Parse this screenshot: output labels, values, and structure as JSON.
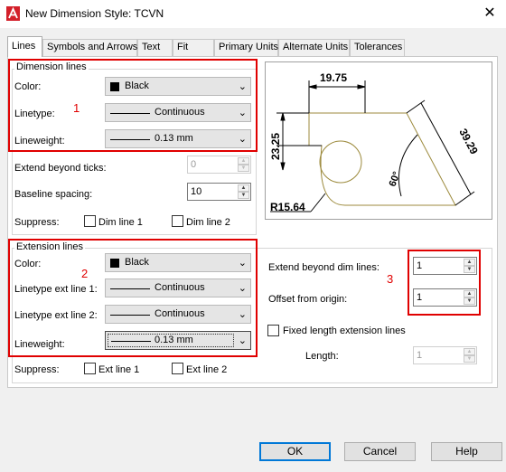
{
  "window": {
    "title": "New Dimension Style: TCVN",
    "close_glyph": "✕"
  },
  "tabs": [
    {
      "label": "Lines"
    },
    {
      "label": "Symbols and Arrows"
    },
    {
      "label": "Text"
    },
    {
      "label": "Fit"
    },
    {
      "label": "Primary Units"
    },
    {
      "label": "Alternate Units"
    },
    {
      "label": "Tolerances"
    }
  ],
  "dimension_lines": {
    "legend": "Dimension lines",
    "color_label": "Color:",
    "color_value": "Black",
    "linetype_label": "Linetype:",
    "linetype_value": "Continuous",
    "lineweight_label": "Lineweight:",
    "lineweight_value": "0.13 mm",
    "extend_ticks_label": "Extend beyond ticks:",
    "extend_ticks_value": "0",
    "baseline_label": "Baseline spacing:",
    "baseline_value": "10",
    "suppress_label": "Suppress:",
    "dim_line1": "Dim line 1",
    "dim_line2": "Dim line 2"
  },
  "extension_lines": {
    "legend": "Extension lines",
    "color_label": "Color:",
    "color_value": "Black",
    "linetype1_label": "Linetype ext line 1:",
    "linetype1_value": "Continuous",
    "linetype2_label": "Linetype ext line 2:",
    "linetype2_value": "Continuous",
    "lineweight_label": "Lineweight:",
    "lineweight_value": "0.13 mm",
    "suppress_label": "Suppress:",
    "ext_line1": "Ext line 1",
    "ext_line2": "Ext line 2"
  },
  "right_settings": {
    "extend_beyond_label": "Extend beyond dim lines:",
    "extend_beyond_value": "1",
    "offset_label": "Offset from origin:",
    "offset_value": "1",
    "fixed_length_label": "Fixed length extension lines",
    "length_label": "Length:",
    "length_value": "1"
  },
  "preview": {
    "dim_top": "19.75",
    "dim_left": "23.25",
    "dim_right": "39.29",
    "angle": "60°",
    "radius": "R15.64"
  },
  "annotations": [
    "1",
    "2",
    "3"
  ],
  "buttons": {
    "ok": "OK",
    "cancel": "Cancel",
    "help": "Help"
  },
  "colors": {
    "accent": "#0078d7",
    "annotation": "#e00000",
    "geometry": "#9c8a3c"
  },
  "icons": {
    "app": "autocad-icon",
    "close": "close-icon",
    "dropdown": "chevron-down-icon"
  }
}
